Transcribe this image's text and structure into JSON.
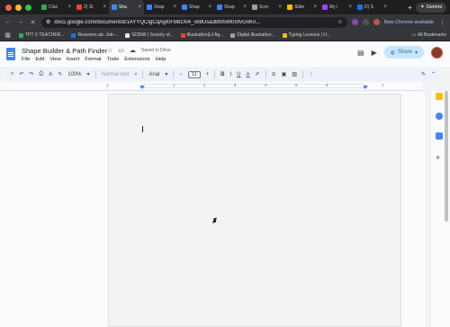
{
  "browser": {
    "tabs": [
      {
        "label": "Clas",
        "color": "#34a853",
        "active": false
      },
      {
        "label": "2) SI",
        "color": "#ea4335",
        "active": false
      },
      {
        "label": "Sha",
        "color": "#4285f4",
        "active": true
      },
      {
        "label": "Shap",
        "color": "#4285f4",
        "active": false
      },
      {
        "label": "Shap",
        "color": "#4285f4",
        "active": false
      },
      {
        "label": "Shap",
        "color": "#4285f4",
        "active": false
      },
      {
        "label": "Scrn",
        "color": "#9aa0a6",
        "active": false
      },
      {
        "label": "Slide",
        "color": "#fbbc04",
        "active": false
      },
      {
        "label": "My I",
        "color": "#a142f4",
        "active": false
      },
      {
        "label": "D) S",
        "color": "#1a73e8",
        "active": false
      }
    ],
    "gemini_label": "Gemini",
    "url": "docs.google.com/document/d/1AYYQCIgCqAgI0FB6zXl4_vb8Usa3BMS6t0SfvGnKn...",
    "new_chrome_label": "New Chrome available",
    "bookmarks": [
      {
        "label": "TPT X TEACHER...",
        "color": "#34a853"
      },
      {
        "label": "Resumes.ab: Job-...",
        "color": "#1a73e8"
      },
      {
        "label": "SCBWI | Society of...",
        "color": "#e8eaed"
      },
      {
        "label": "Illustration|Lil Ag...",
        "color": "#ea4335"
      },
      {
        "label": "Digital Illustration...",
        "color": "#9aa0a6"
      },
      {
        "label": "Typing Lessons | U...",
        "color": "#fbbc04"
      }
    ],
    "all_bookmarks_label": "All Bookmarks"
  },
  "doc": {
    "title": "Shape Builder & Path Finder",
    "saved_status": "Saved to Drive",
    "menu": [
      "File",
      "Edit",
      "View",
      "Insert",
      "Format",
      "Tools",
      "Extensions",
      "Help"
    ],
    "share_label": "Share",
    "toolbar": {
      "zoom": "100%",
      "style": "Normal text",
      "font": "Arial",
      "font_size": "11"
    },
    "ruler_numbers": [
      "1",
      "1",
      "2",
      "3",
      "4",
      "5",
      "6",
      "7"
    ]
  },
  "colors": {
    "accent": "#4285f4",
    "share_bg": "#c2e7ff"
  }
}
